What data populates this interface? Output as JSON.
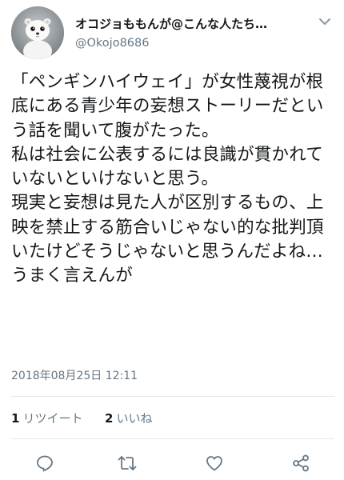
{
  "user": {
    "display_name": "オコジョももんが@こんな人たち…",
    "handle": "@Okojo8686"
  },
  "tweet": {
    "text": "「ペンギンハイウェイ」が女性蔑視が根底にある青少年の妄想ストーリーだという話を聞いて腹がたった。\n私は社会に公表するには良識が貫かれていないといけないと思う。\n現実と妄想は見た人が区別するもの、上映を禁止する筋合いじゃない的な批判頂いたけどそうじゃないと思うんだよね…うまく言えんが",
    "timestamp": "2018年08月25日 12:11"
  },
  "stats": {
    "retweets_count": "1",
    "retweets_label": "リツイート",
    "likes_count": "2",
    "likes_label": "いいね"
  },
  "icons": {
    "menu": "chevron-down-icon",
    "reply": "reply-icon",
    "retweet": "retweet-icon",
    "like": "heart-icon",
    "share": "share-icon"
  },
  "colors": {
    "text": "#14171a",
    "secondary": "#657786",
    "divider": "#e1e8ed"
  }
}
